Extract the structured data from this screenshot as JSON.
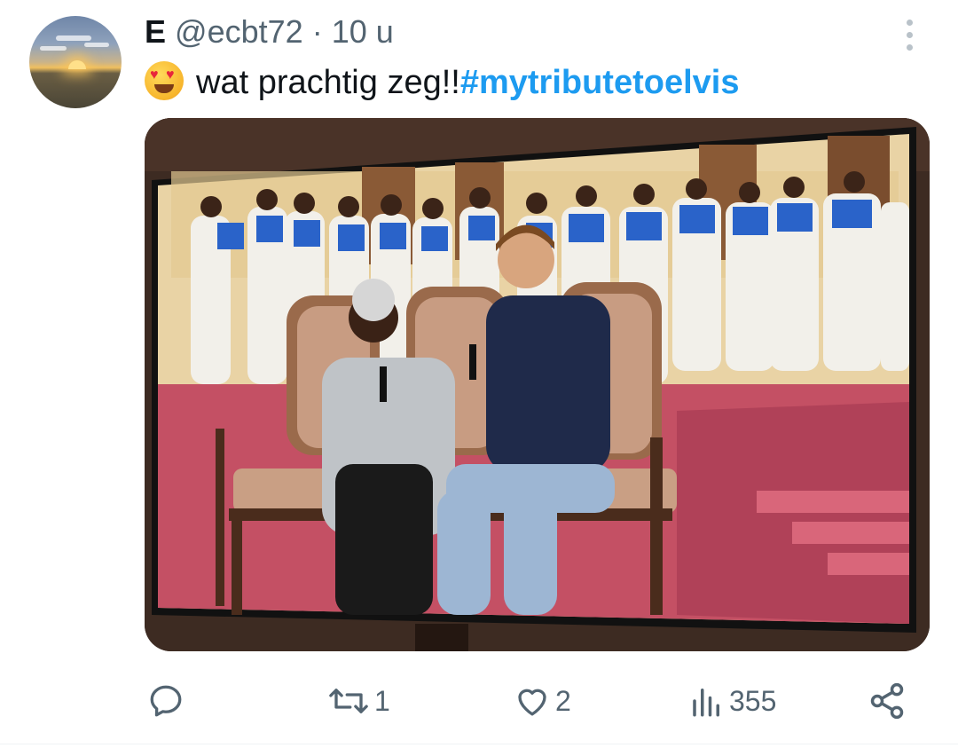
{
  "author": {
    "display_name": "E",
    "handle": "@ecbt72",
    "separator": "·",
    "time": "10 u"
  },
  "tweet": {
    "text": "wat prachtig zeg!!",
    "hashtag": "#mytributetoelvis",
    "emoji": "smiling-face-with-heart-eyes"
  },
  "media": {
    "description_icon": "photo-of-tv-screen"
  },
  "actions": {
    "reply": {
      "icon": "reply-icon",
      "count": ""
    },
    "retweet": {
      "icon": "retweet-icon",
      "count": "1"
    },
    "like": {
      "icon": "like-icon",
      "count": "2"
    },
    "views": {
      "icon": "views-icon",
      "count": "355"
    },
    "share": {
      "icon": "share-icon",
      "count": ""
    }
  },
  "colors": {
    "text_primary": "#0f1419",
    "text_secondary": "#536471",
    "link": "#1d9bf0"
  }
}
